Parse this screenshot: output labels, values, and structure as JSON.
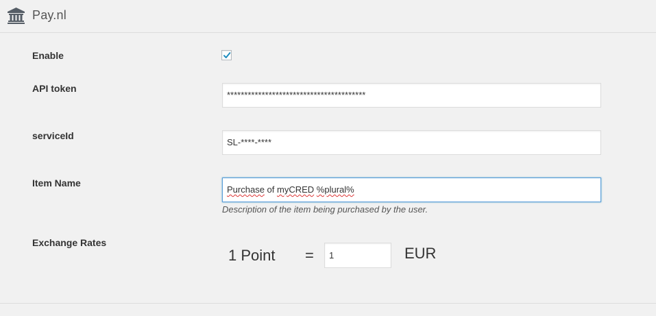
{
  "header": {
    "title": "Pay.nl",
    "icon": "bank-icon"
  },
  "fields": {
    "enable": {
      "label": "Enable",
      "checked": true
    },
    "api_token": {
      "label": "API token",
      "value": "****************************************"
    },
    "service_id": {
      "label": "serviceId",
      "value": "SL-****-****"
    },
    "item_name": {
      "label": "Item Name",
      "value_parts": [
        "Purchase",
        " of ",
        "myCRED",
        " ",
        "%plural%"
      ],
      "description": "Description of the item being purchased by the user."
    },
    "exchange_rates": {
      "label": "Exchange Rates",
      "point_label": "1 Point",
      "equals": "=",
      "rate_value": "1",
      "currency": "EUR"
    }
  },
  "colors": {
    "background": "#f1f1f1",
    "checkmark": "#1e8cbe",
    "focus_border": "#5b9dd9",
    "spellcheck_underline": "#dd3333"
  }
}
